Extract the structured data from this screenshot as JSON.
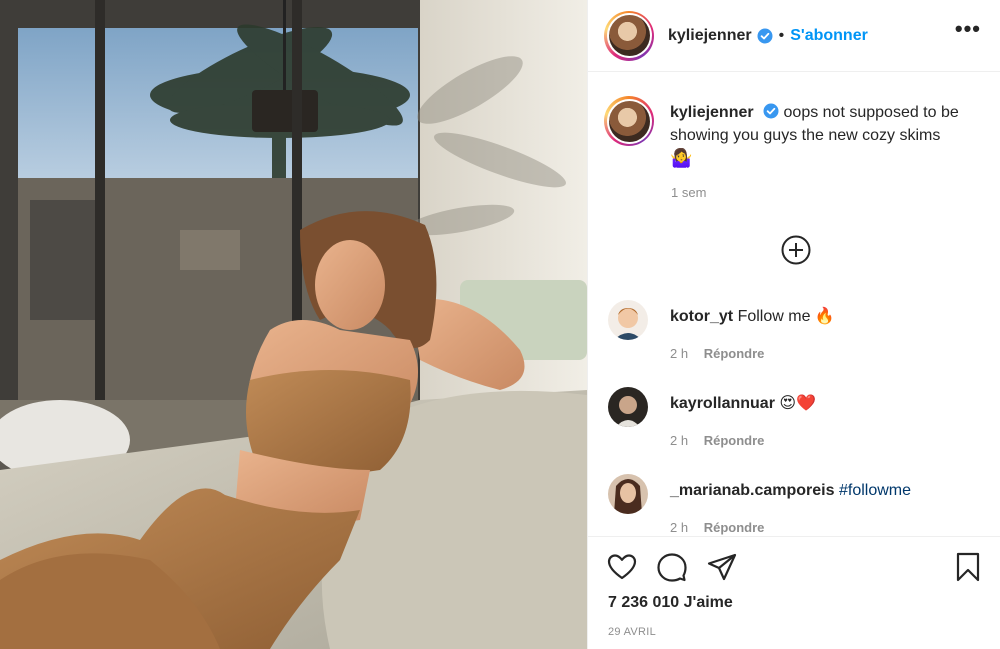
{
  "post": {
    "username": "kyliejenner",
    "follow_label": "S'abonner",
    "separator": "•",
    "more_label": "•••",
    "caption_text": "oops not supposed to be showing you guys the new cozy skims",
    "caption_emoji": "🤷‍♀️",
    "caption_time": "1 sem",
    "likes": "7 236 010 J'aime",
    "date": "29 AVRIL"
  },
  "comments": [
    {
      "username": "kotor_yt",
      "text": "Follow me 🔥",
      "hashtag": "",
      "time": "2 h",
      "reply_label": "Répondre"
    },
    {
      "username": "kayrollannuar",
      "text": "😍❤️",
      "hashtag": "",
      "time": "2 h",
      "reply_label": "Répondre"
    },
    {
      "username": "_marianab.camporeis",
      "text": "",
      "hashtag": "#followme",
      "time": "2 h",
      "reply_label": "Répondre"
    }
  ],
  "icons": {
    "verified": "verified-badge-icon",
    "load_more": "plus-circle-icon",
    "like": "heart-icon",
    "comment": "comment-bubble-icon",
    "share": "paper-plane-icon",
    "save": "bookmark-icon"
  },
  "colors": {
    "accent": "#0095f6",
    "text": "#262626",
    "muted": "#8e8e8e",
    "hashtag": "#00376b",
    "border": "#efefef"
  }
}
